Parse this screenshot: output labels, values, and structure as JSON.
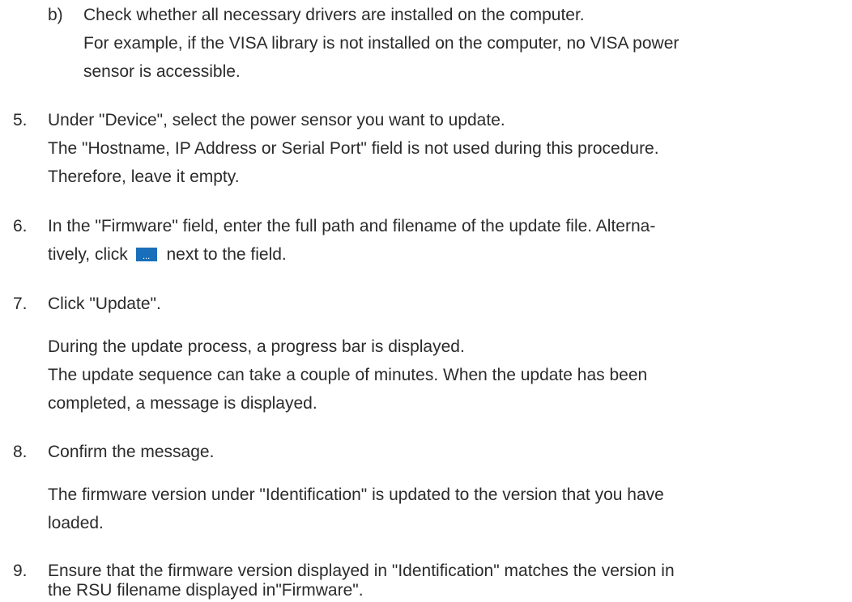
{
  "sub_b": {
    "marker": "b)",
    "lines": [
      "Check whether all necessary drivers are installed on the computer.",
      "For example, if the VISA library is not installed on the computer, no VISA power",
      "sensor is accessible."
    ]
  },
  "step5": {
    "marker": "5.",
    "lines": [
      "Under \"Device\", select the power sensor you want to update.",
      "The \"Hostname, IP Address or Serial Port\" field is not used during this procedure.",
      "Therefore, leave it empty."
    ]
  },
  "step6": {
    "marker": "6.",
    "line1": "In the \"Firmware\" field, enter the full path and filename of the update file. Alterna-",
    "line2_before": "tively, click",
    "line2_after": "next to the field.",
    "browse_icon": "browse-ellipsis-icon"
  },
  "step7": {
    "marker": "7.",
    "lines": [
      "Click \"Update\".",
      "During the update process, a progress bar is displayed.",
      "The update sequence can take a couple of minutes. When the update has been",
      "completed, a message is displayed."
    ]
  },
  "step8": {
    "marker": "8.",
    "lines": [
      "Confirm the message.",
      "The firmware version under \"Identification\" is updated to the version that you have",
      "loaded."
    ]
  },
  "step9": {
    "marker": "9.",
    "lines": [
      "Ensure that the firmware version displayed in \"Identification\" matches the version in",
      "the RSU filename displayed in\"Firmware\"."
    ]
  },
  "colors": {
    "text": "#2b2b2b",
    "browse_button": "#1a6fba"
  }
}
